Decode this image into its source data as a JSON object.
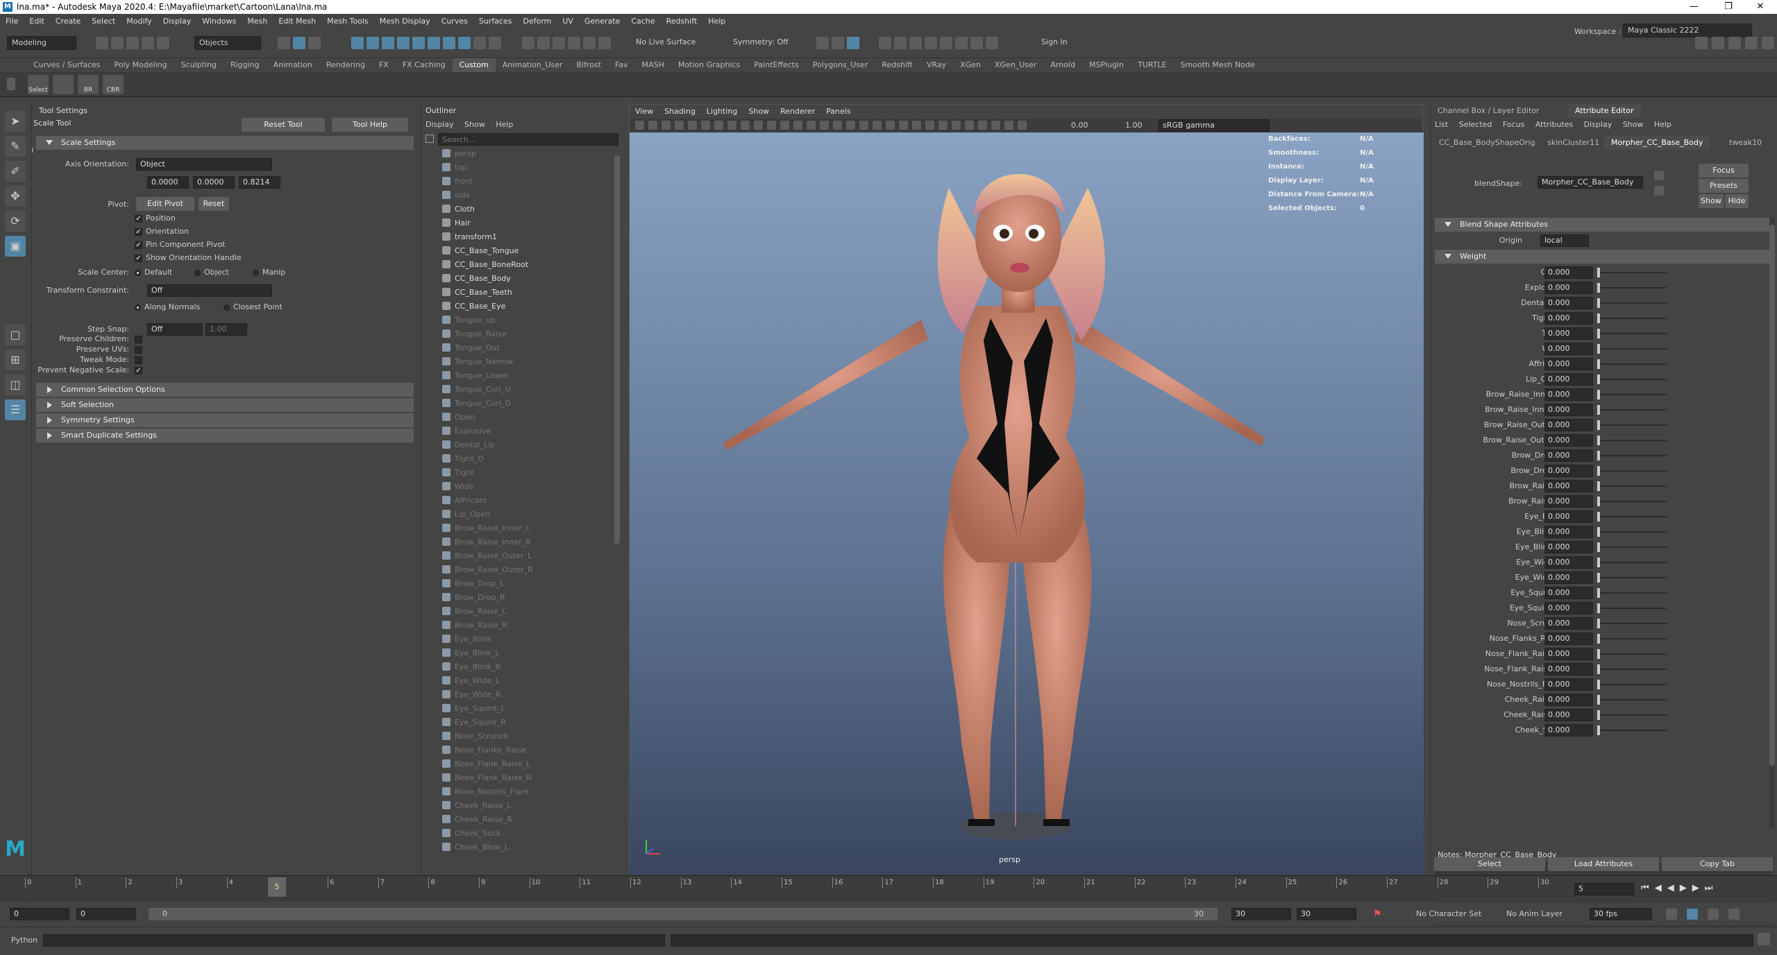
{
  "window": {
    "title": "lna.ma* - Autodesk Maya 2020.4: E:\\Mayafile\\market\\Cartoon\\Lana\\lna.ma",
    "app_icon": "M",
    "controls": [
      "—",
      "❐",
      "✕"
    ]
  },
  "menubar": [
    "File",
    "Edit",
    "Create",
    "Select",
    "Modify",
    "Display",
    "Windows",
    "Mesh",
    "Edit Mesh",
    "Mesh Tools",
    "Mesh Display",
    "Curves",
    "Surfaces",
    "Deform",
    "UV",
    "Generate",
    "Cache",
    "Redshift",
    "Help"
  ],
  "status_line": {
    "mode_menu": "Modeling",
    "objects_label": "Objects",
    "live_surface": "No Live Surface",
    "symmetry": "Symmetry: Off",
    "sign_in": "Sign In",
    "workspace_label": "Workspace :",
    "workspace_value": "Maya Classic 2222"
  },
  "shelf": {
    "tabs": [
      "Curves / Surfaces",
      "Poly Modeling",
      "Sculpting",
      "Rigging",
      "Animation",
      "Rendering",
      "FX",
      "FX Caching",
      "Custom",
      "Animation_User",
      "Bifrost",
      "Fav",
      "MASH",
      "Motion Graphics",
      "PaintEffects",
      "Polygons_User",
      "Redshift",
      "VRay",
      "XGen",
      "XGen_User",
      "Arnold",
      "MSPlugin",
      "TURTLE",
      "Smooth Mesh Node"
    ],
    "active_tab": "Custom",
    "buttons": [
      "Select a Mouse",
      "",
      "BR",
      "CBR"
    ]
  },
  "tool_settings": {
    "panel_title": "Tool Settings",
    "tool_name": "Scale Tool",
    "reset_button": "Reset Tool",
    "help_button": "Tool Help",
    "section_scale": "Scale Settings",
    "axis_orientation_label": "Axis Orientation:",
    "axis_orientation_value": "Object",
    "axis_values": [
      "0.0000",
      "0.0000",
      "0.8214"
    ],
    "pivot_label": "Pivot:",
    "edit_pivot": "Edit Pivot",
    "reset": "Reset",
    "pivot_checks": [
      "Position",
      "Orientation",
      "Pin Component Pivot",
      "Show Orientation Handle"
    ],
    "scale_center_label": "Scale Center:",
    "scale_center_options": [
      "Default",
      "Object",
      "Manip"
    ],
    "transform_constraint_label": "Transform Constraint:",
    "transform_constraint_value": "Off",
    "constraint_options": [
      "Along Normals",
      "Closest Point"
    ],
    "step_snap_label": "Step Snap:",
    "step_snap_value": "Off",
    "step_snap_amount": "1.00",
    "extra_labels": [
      "Preserve Children:",
      "Preserve UVs:",
      "Tweak Mode:",
      "Prevent Negative Scale:"
    ],
    "collapsed_sections": [
      "Common Selection Options",
      "Soft Selection",
      "Symmetry Settings",
      "Smart Duplicate Settings"
    ]
  },
  "outliner": {
    "title": "Outliner",
    "menu": [
      "Display",
      "Show",
      "Help"
    ],
    "search_placeholder": "Search...",
    "items": [
      {
        "label": "persp",
        "dim": true
      },
      {
        "label": "top",
        "dim": true
      },
      {
        "label": "front",
        "dim": true
      },
      {
        "label": "side",
        "dim": true
      },
      {
        "label": "Cloth",
        "dim": false
      },
      {
        "label": "Hair",
        "dim": false
      },
      {
        "label": "transform1",
        "dim": false
      },
      {
        "label": "CC_Base_Tongue",
        "dim": false
      },
      {
        "label": "CC_Base_BoneRoot",
        "dim": false
      },
      {
        "label": "CC_Base_Body",
        "dim": false
      },
      {
        "label": "CC_Base_Teeth",
        "dim": false
      },
      {
        "label": "CC_Base_Eye",
        "dim": false
      },
      {
        "label": "Tongue_up",
        "dim": true
      },
      {
        "label": "Tongue_Raise",
        "dim": true
      },
      {
        "label": "Tongue_Out",
        "dim": true
      },
      {
        "label": "Tongue_Narrow",
        "dim": true
      },
      {
        "label": "Tongue_Lower",
        "dim": true
      },
      {
        "label": "Tongue_Curl_U",
        "dim": true
      },
      {
        "label": "Tongue_Curl_D",
        "dim": true
      },
      {
        "label": "Open",
        "dim": true
      },
      {
        "label": "Explosive",
        "dim": true
      },
      {
        "label": "Dental_Lip",
        "dim": true
      },
      {
        "label": "Tight_O",
        "dim": true
      },
      {
        "label": "Tight",
        "dim": true
      },
      {
        "label": "Wide",
        "dim": true
      },
      {
        "label": "Affricate",
        "dim": true
      },
      {
        "label": "Lip_Open",
        "dim": true
      },
      {
        "label": "Brow_Raise_Inner_L",
        "dim": true
      },
      {
        "label": "Brow_Raise_Inner_R",
        "dim": true
      },
      {
        "label": "Brow_Raise_Outer_L",
        "dim": true
      },
      {
        "label": "Brow_Raise_Outer_R",
        "dim": true
      },
      {
        "label": "Brow_Drop_L",
        "dim": true
      },
      {
        "label": "Brow_Drop_R",
        "dim": true
      },
      {
        "label": "Brow_Raise_L",
        "dim": true
      },
      {
        "label": "Brow_Raise_R",
        "dim": true
      },
      {
        "label": "Eye_Blink",
        "dim": true
      },
      {
        "label": "Eye_Blink_L",
        "dim": true
      },
      {
        "label": "Eye_Blink_R",
        "dim": true
      },
      {
        "label": "Eye_Wide_L",
        "dim": true
      },
      {
        "label": "Eye_Wide_R",
        "dim": true
      },
      {
        "label": "Eye_Squint_L",
        "dim": true
      },
      {
        "label": "Eye_Squint_R",
        "dim": true
      },
      {
        "label": "Nose_Scrunch",
        "dim": true
      },
      {
        "label": "Nose_Flanks_Raise",
        "dim": true
      },
      {
        "label": "Nose_Flank_Raise_L",
        "dim": true
      },
      {
        "label": "Nose_Flank_Raise_R",
        "dim": true
      },
      {
        "label": "Nose_Nostrils_Flare",
        "dim": true
      },
      {
        "label": "Cheek_Raise_L",
        "dim": true
      },
      {
        "label": "Cheek_Raise_R",
        "dim": true
      },
      {
        "label": "Cheek_Suck",
        "dim": true
      },
      {
        "label": "Cheek_Blow_L",
        "dim": true
      }
    ]
  },
  "viewport": {
    "menu": [
      "View",
      "Shading",
      "Lighting",
      "Show",
      "Renderer",
      "Panels"
    ],
    "exposure": "0.00",
    "gamma": "1.00",
    "color_space": "sRGB gamma",
    "camera_label": "persp",
    "hud": [
      {
        "label": "Backfaces:",
        "value": "N/A"
      },
      {
        "label": "Smoothness:",
        "value": "N/A"
      },
      {
        "label": "Instance:",
        "value": "N/A"
      },
      {
        "label": "Display Layer:",
        "value": "N/A"
      },
      {
        "label": "Distance From Camera:",
        "value": "N/A"
      },
      {
        "label": "Selected Objects:",
        "value": "0"
      }
    ]
  },
  "attribute_editor": {
    "header_tabs": [
      "Channel Box / Layer Editor",
      "Attribute Editor"
    ],
    "menu": [
      "List",
      "Selected",
      "Focus",
      "Attributes",
      "Display",
      "Show",
      "Help"
    ],
    "node_tabs": [
      "CC_Base_BodyShapeOrig",
      "skinCluster11",
      "Morpher_CC_Base_Body",
      "tweak10"
    ],
    "active_node_tab": "Morpher_CC_Base_Body",
    "blendshape_label": "blendShape:",
    "blendshape_value": "Morpher_CC_Base_Body",
    "focus": "Focus",
    "presets": "Presets",
    "show": "Show",
    "hide": "Hide",
    "section_blend": "Blend Shape Attributes",
    "origin_label": "Origin",
    "origin_value": "local",
    "section_weight": "Weight",
    "weights": [
      {
        "name": "Open",
        "value": "0.000"
      },
      {
        "name": "Explosive",
        "value": "0.000"
      },
      {
        "name": "Dental_Lip",
        "value": "0.000"
      },
      {
        "name": "Tight_O",
        "value": "0.000"
      },
      {
        "name": "Tight",
        "value": "0.000"
      },
      {
        "name": "Wide",
        "value": "0.000"
      },
      {
        "name": "Affricate",
        "value": "0.000"
      },
      {
        "name": "Lip_Open",
        "value": "0.000"
      },
      {
        "name": "Brow_Raise_Inner_L",
        "value": "0.000"
      },
      {
        "name": "Brow_Raise_Inner_R",
        "value": "0.000"
      },
      {
        "name": "Brow_Raise_Outer_L",
        "value": "0.000"
      },
      {
        "name": "Brow_Raise_Outer_R",
        "value": "0.000"
      },
      {
        "name": "Brow_Drop_L",
        "value": "0.000"
      },
      {
        "name": "Brow_Drop_R",
        "value": "0.000"
      },
      {
        "name": "Brow_Raise_L",
        "value": "0.000"
      },
      {
        "name": "Brow_Raise_R",
        "value": "0.000"
      },
      {
        "name": "Eye_Blink",
        "value": "0.000"
      },
      {
        "name": "Eye_Blink_L",
        "value": "0.000"
      },
      {
        "name": "Eye_Blink_R",
        "value": "0.000"
      },
      {
        "name": "Eye_Wide_L",
        "value": "0.000"
      },
      {
        "name": "Eye_Wide_R",
        "value": "0.000"
      },
      {
        "name": "Eye_Squint_L",
        "value": "0.000"
      },
      {
        "name": "Eye_Squint_R",
        "value": "0.000"
      },
      {
        "name": "Nose_Scrunch",
        "value": "0.000"
      },
      {
        "name": "Nose_Flanks_Raise",
        "value": "0.000"
      },
      {
        "name": "Nose_Flank_Raise_L",
        "value": "0.000"
      },
      {
        "name": "Nose_Flank_Raise_R",
        "value": "0.000"
      },
      {
        "name": "Nose_Nostrils_Flare",
        "value": "0.000"
      },
      {
        "name": "Cheek_Raise_L",
        "value": "0.000"
      },
      {
        "name": "Cheek_Raise_R",
        "value": "0.000"
      },
      {
        "name": "Cheek_Suck",
        "value": "0.000"
      }
    ],
    "notes": "Notes:  Morpher_CC_Base_Body",
    "bottom_buttons": [
      "Select",
      "Load Attributes",
      "Copy Tab"
    ]
  },
  "timeline": {
    "ticks": [
      "0",
      "1",
      "2",
      "3",
      "4",
      "5",
      "6",
      "7",
      "8",
      "9",
      "10",
      "11",
      "12",
      "13",
      "14",
      "15",
      "16",
      "17",
      "18",
      "19",
      "20",
      "21",
      "22",
      "23",
      "24",
      "25",
      "26",
      "27",
      "28",
      "29",
      "30"
    ],
    "current_frame": "5",
    "frame_field": "5"
  },
  "range": {
    "start": "0",
    "anim_start": "0",
    "slider_start": "0",
    "slider_end": "30",
    "anim_end": "30",
    "end": "30",
    "character_set": "No Character Set",
    "anim_layer": "No Anim Layer",
    "fps": "30 fps"
  },
  "command_line": {
    "language": "Python"
  },
  "colors": {
    "accent": "#5285a6",
    "panel_bg": "#444444",
    "field_bg": "#2b2b2b"
  }
}
